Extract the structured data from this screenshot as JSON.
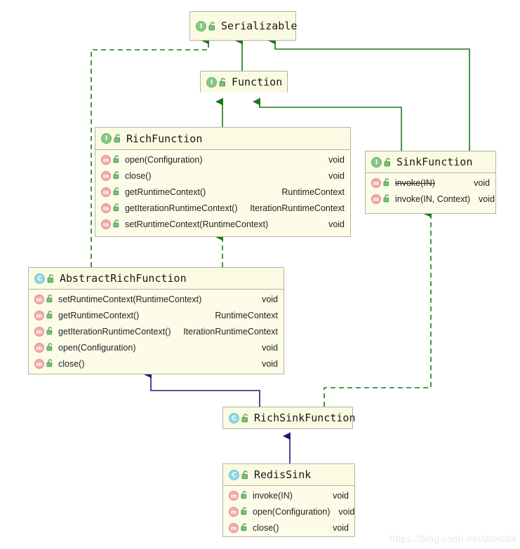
{
  "diagram": {
    "title": "Flink RedisSink class hierarchy",
    "colors": {
      "box_fill": "#fcfce8",
      "box_border": "#b4b4a0",
      "interface_icon": "#86c986",
      "class_icon": "#8fd9e8",
      "method_icon": "#f4a9ae",
      "realization_edge": "#1a7a1a",
      "inheritance_edge": "#1a1a7a",
      "watermark": "#e8e8e8"
    },
    "watermark": "https://blog.csdn.net/duxu24",
    "nodes": [
      {
        "id": "serializable",
        "name": "Serializable",
        "stereotype": "interface",
        "icon": "interface-icon",
        "visibility_icon": "unlocked-padlock-icon",
        "members": []
      },
      {
        "id": "function",
        "name": "Function",
        "stereotype": "interface",
        "icon": "interface-icon",
        "visibility_icon": "unlocked-padlock-icon",
        "members": []
      },
      {
        "id": "richfunction",
        "name": "RichFunction",
        "stereotype": "interface",
        "icon": "interface-icon",
        "visibility_icon": "unlocked-padlock-icon",
        "members": [
          {
            "name": "open(Configuration)",
            "type": "void",
            "deprecated": false
          },
          {
            "name": "close()",
            "type": "void",
            "deprecated": false
          },
          {
            "name": "getRuntimeContext()",
            "type": "RuntimeContext",
            "deprecated": false
          },
          {
            "name": "getIterationRuntimeContext()",
            "type": "IterationRuntimeContext",
            "deprecated": false
          },
          {
            "name": "setRuntimeContext(RuntimeContext)",
            "type": "void",
            "deprecated": false
          }
        ]
      },
      {
        "id": "sinkfunction",
        "name": "SinkFunction",
        "stereotype": "interface",
        "icon": "interface-icon",
        "visibility_icon": "unlocked-padlock-icon",
        "members": [
          {
            "name": "invoke(IN)",
            "type": "void",
            "deprecated": true
          },
          {
            "name": "invoke(IN, Context)",
            "type": "void",
            "deprecated": false
          }
        ]
      },
      {
        "id": "abstractrichfunction",
        "name": "AbstractRichFunction",
        "stereotype": "class",
        "icon": "class-icon",
        "visibility_icon": "unlocked-padlock-icon",
        "members": [
          {
            "name": "setRuntimeContext(RuntimeContext)",
            "type": "void",
            "deprecated": false
          },
          {
            "name": "getRuntimeContext()",
            "type": "RuntimeContext",
            "deprecated": false
          },
          {
            "name": "getIterationRuntimeContext()",
            "type": "IterationRuntimeContext",
            "deprecated": false
          },
          {
            "name": "open(Configuration)",
            "type": "void",
            "deprecated": false
          },
          {
            "name": "close()",
            "type": "void",
            "deprecated": false
          }
        ]
      },
      {
        "id": "richsinkfunction",
        "name": "RichSinkFunction",
        "stereotype": "class",
        "icon": "class-icon",
        "visibility_icon": "unlocked-padlock-icon",
        "members": []
      },
      {
        "id": "redissink",
        "name": "RedisSink",
        "stereotype": "class",
        "icon": "class-icon",
        "visibility_icon": "unlocked-padlock-icon",
        "members": [
          {
            "name": "invoke(IN)",
            "type": "void",
            "deprecated": false
          },
          {
            "name": "open(Configuration)",
            "type": "void",
            "deprecated": false
          },
          {
            "name": "close()",
            "type": "void",
            "deprecated": false
          }
        ]
      }
    ],
    "edges": [
      {
        "from": "function",
        "to": "serializable",
        "kind": "extends",
        "style": "solid",
        "color": "green"
      },
      {
        "from": "sinkfunction",
        "to": "serializable",
        "kind": "extends",
        "style": "solid",
        "color": "green"
      },
      {
        "from": "abstractrichfunction",
        "to": "serializable",
        "kind": "implements",
        "style": "dashed",
        "color": "green"
      },
      {
        "from": "richfunction",
        "to": "function",
        "kind": "extends",
        "style": "solid",
        "color": "green"
      },
      {
        "from": "sinkfunction",
        "to": "function",
        "kind": "extends",
        "style": "solid",
        "color": "green"
      },
      {
        "from": "abstractrichfunction",
        "to": "richfunction",
        "kind": "implements",
        "style": "dashed",
        "color": "green"
      },
      {
        "from": "richsinkfunction",
        "to": "abstractrichfunction",
        "kind": "extends",
        "style": "solid",
        "color": "navy"
      },
      {
        "from": "richsinkfunction",
        "to": "sinkfunction",
        "kind": "implements",
        "style": "dashed",
        "color": "green"
      },
      {
        "from": "redissink",
        "to": "richsinkfunction",
        "kind": "extends",
        "style": "solid",
        "color": "navy"
      }
    ]
  }
}
